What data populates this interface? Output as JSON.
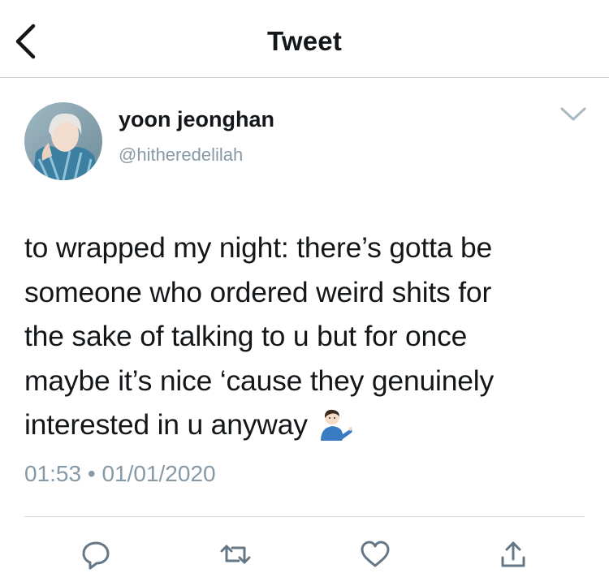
{
  "header": {
    "title": "Tweet",
    "back_icon": "chevron-left-icon"
  },
  "author": {
    "name": "yoon jeonghan",
    "handle": "@hitheredelilah"
  },
  "tweet": {
    "text": "to wrapped my night: there’s gotta be\nsomeone who ordered weird shits for\nthe sake of talking to u but for once\nmaybe it’s nice ‘cause they genuinely\ninterested in u anyway ",
    "emoji": "person-shrugging-icon",
    "time": "01:53",
    "separator": "•",
    "date": "01/01/2020"
  },
  "actions": [
    "reply-icon",
    "retweet-icon",
    "like-icon",
    "share-icon"
  ],
  "colors": {
    "text": "#14171a",
    "secondary": "#8899a6",
    "divider": "#d5d9dc"
  }
}
